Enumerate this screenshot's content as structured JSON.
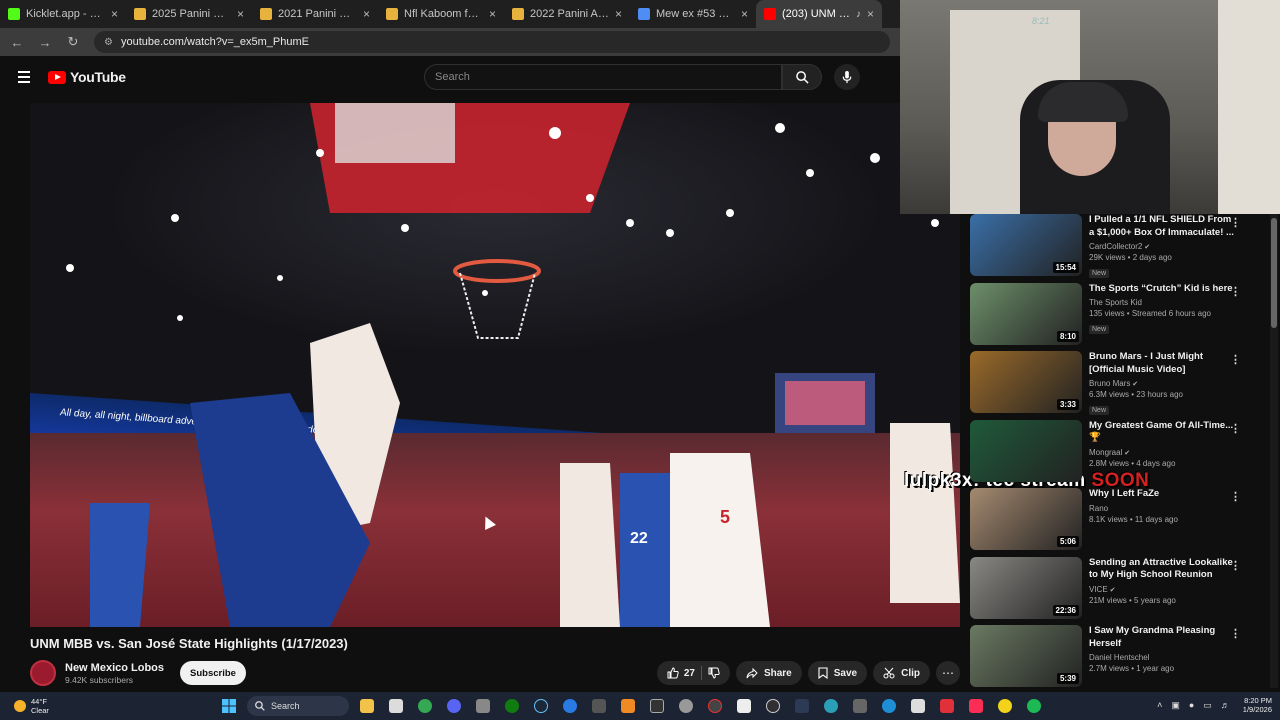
{
  "browser": {
    "tabs": [
      {
        "title": "Kicklet.app - Kick Chat",
        "fav": "#53fc18",
        "active": false
      },
      {
        "title": "2025 Panini Revolution",
        "fav": "#e8b33c",
        "active": false
      },
      {
        "title": "2021 Panini NFL Player",
        "fav": "#e8b33c",
        "active": false
      },
      {
        "title": "Nfl Kaboom for sale |",
        "fav": "#e8b33c",
        "active": false
      },
      {
        "title": "2022 Panini Absolute",
        "fav": "#e8b33c",
        "active": false
      },
      {
        "title": "Mew ex #53 Prices | P",
        "fav": "#4f8df5",
        "active": false
      },
      {
        "title": "(203) UNM MBB v",
        "fav": "#ff0000",
        "active": true
      }
    ],
    "url": "youtube.com/watch?v=_ex5m_PhumE"
  },
  "youtube": {
    "logo_text": "YouTube",
    "search_placeholder": "Search"
  },
  "video": {
    "title": "UNM MBB vs. San José State Highlights (1/17/2023)",
    "ribbon_text": "All day, all night, billboard advertising that never neither do",
    "overlay_name": "lulpk3x: tec stream ",
    "overlay_soon": "SOON",
    "channel_name": "New Mexico Lobos",
    "subscribers": "9.42K subscribers",
    "subscribe_label": "Subscribe",
    "likes": "27",
    "share_label": "Share",
    "save_label": "Save",
    "clip_label": "Clip"
  },
  "webcam": {
    "clock": "8:21"
  },
  "recommendations": [
    {
      "title": "I Pulled a 1/1 NFL SHIELD From a $1,000+ Box Of Immaculate! ...",
      "channel": "CardCollector2",
      "verified": true,
      "meta": "29K views • 2 days ago",
      "tag": "New",
      "duration": "15:54",
      "color": "#3a6fa8"
    },
    {
      "title": "The Sports “Crutch” Kid is here",
      "channel": "The Sports Kid",
      "verified": false,
      "meta": "135 views • Streamed 6 hours ago",
      "tag": "New",
      "duration": "8:10",
      "color": "#6d8f6a"
    },
    {
      "title": "Bruno Mars - I Just Might [Official Music Video]",
      "channel": "Bruno Mars",
      "verified": true,
      "meta": "6.3M views • 23 hours ago",
      "tag": "New",
      "duration": "3:33",
      "color": "#9a6a2a"
    },
    {
      "title": "My Greatest Game Of All-Time... 🏆",
      "channel": "Mongraal",
      "verified": true,
      "meta": "2.8M views • 4 days ago",
      "tag": "",
      "duration": "",
      "color": "#1f5a3a"
    },
    {
      "title": "Why I Left FaZe",
      "channel": "Rano",
      "verified": false,
      "meta": "8.1K views • 11 days ago",
      "tag": "",
      "duration": "5:06",
      "color": "#a58a70"
    },
    {
      "title": "Sending an Attractive Lookalike to My High School Reunion",
      "channel": "VICE",
      "verified": true,
      "meta": "21M views • 5 years ago",
      "tag": "",
      "duration": "22:36",
      "color": "#8a8884"
    },
    {
      "title": "I Saw My Grandma Pleasing Herself",
      "channel": "Daniel Hentschel",
      "verified": false,
      "meta": "2.7M views • 1 year ago",
      "tag": "",
      "duration": "5:39",
      "color": "#6a7a62"
    }
  ],
  "taskbar": {
    "weather_temp": "44°F",
    "weather_desc": "Clear",
    "search_label": "Search",
    "time": "8:20 PM",
    "date": "1/9/2026"
  }
}
